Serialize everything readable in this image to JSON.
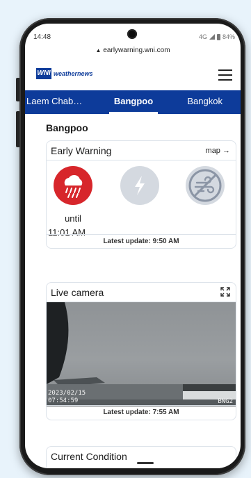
{
  "status_bar": {
    "time": "14:48",
    "network": "4G",
    "battery": "84%"
  },
  "browser": {
    "url": "earlywarning.wni.com"
  },
  "header": {
    "logo_mark": "WNI",
    "logo_text": "weathernews"
  },
  "tabs": [
    {
      "label": "Laem Chab…",
      "active": false
    },
    {
      "label": "Bangpoo",
      "active": true
    },
    {
      "label": "Bangkok",
      "active": false
    }
  ],
  "page": {
    "title": "Bangpoo"
  },
  "early_warning": {
    "title": "Early Warning",
    "map_link": "map →",
    "icons": [
      {
        "name": "heavy-rain-icon",
        "active": true,
        "color": "#d7262b"
      },
      {
        "name": "thunder-icon",
        "active": false,
        "color": "#d4d9e0"
      },
      {
        "name": "strong-wind-icon",
        "active": false,
        "color": "#d4d9e0"
      }
    ],
    "until_label": "until",
    "until_time": "11:01 AM",
    "latest_update": "Latest update: 9:50 AM"
  },
  "live_camera": {
    "title": "Live camera",
    "timestamp_date": "2023/02/15",
    "timestamp_time": "07:54:59",
    "camera_id": "BNG2",
    "latest_update": "Latest update: 7:55 AM"
  },
  "current_condition": {
    "title": "Current Condition"
  },
  "colors": {
    "brand_blue": "#0d3b9a",
    "alert_red": "#d7262b",
    "inactive_gray": "#d4d9e0"
  }
}
